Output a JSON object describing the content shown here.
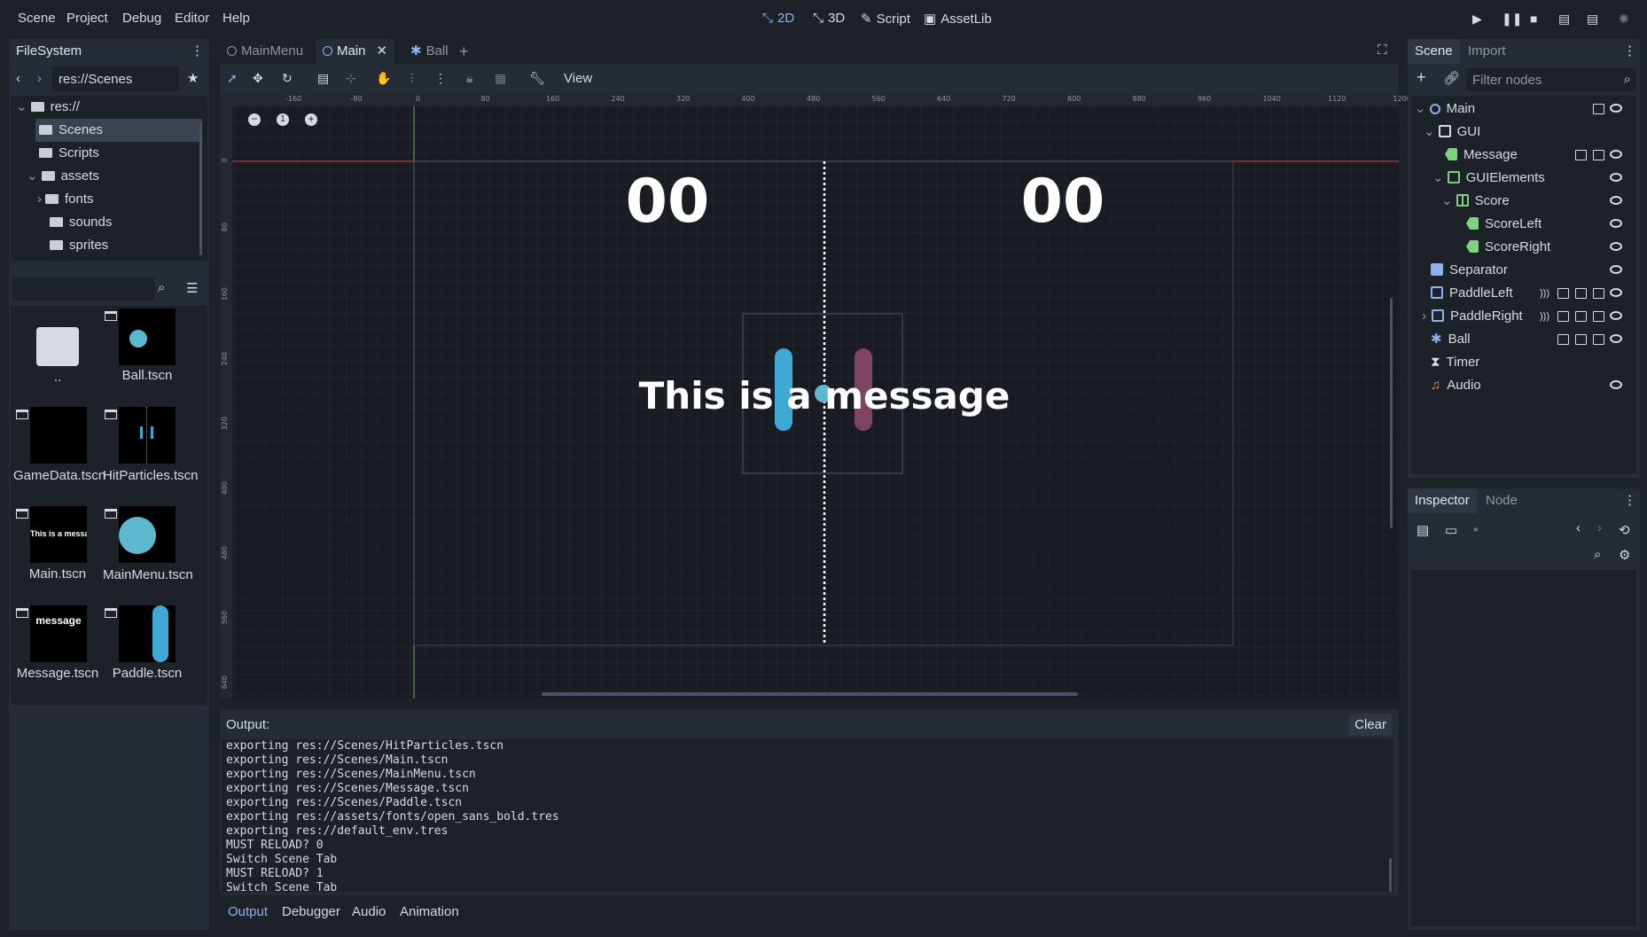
{
  "menubar": {
    "items": [
      "Scene",
      "Project",
      "Debug",
      "Editor",
      "Help"
    ],
    "workspaces": {
      "w2d": "2D",
      "w3d": "3D",
      "script": "Script",
      "assetlib": "AssetLib"
    }
  },
  "filesystem": {
    "title": "FileSystem",
    "path": "res://Scenes",
    "tree": {
      "root": "res://",
      "scenes": "Scenes",
      "scripts": "Scripts",
      "assets": "assets",
      "fonts": "fonts",
      "sounds": "sounds",
      "sprites": "sprites"
    },
    "files": {
      "up": "..",
      "ball": "Ball.tscn",
      "gamedata": "GameData.tscn",
      "hitparticles": "HitParticles.tscn",
      "main": "Main.tscn",
      "mainmenu": "MainMenu.tscn",
      "message": "Message.tscn",
      "paddle": "Paddle.tscn"
    },
    "thumb_text": {
      "main": "This is a message",
      "message": "message"
    }
  },
  "editor_tabs": {
    "mainmenu": "MainMenu",
    "main": "Main",
    "ball": "Ball"
  },
  "toolbar": {
    "view": "View"
  },
  "viewport": {
    "score_left": "00",
    "score_right": "00",
    "message": "This is a message",
    "ruler_x": [
      "-160",
      "-80",
      "0",
      "80",
      "160",
      "240",
      "320",
      "400",
      "480",
      "560",
      "640",
      "720",
      "800",
      "880",
      "960",
      "1040",
      "1120",
      "1200"
    ],
    "ruler_y": [
      "0",
      "80",
      "160",
      "240",
      "320",
      "400",
      "480",
      "560",
      "640"
    ]
  },
  "scene_dock": {
    "tab_scene": "Scene",
    "tab_import": "Import",
    "filter_placeholder": "Filter nodes",
    "nodes": {
      "main": "Main",
      "gui": "GUI",
      "message": "Message",
      "guielements": "GUIElements",
      "score": "Score",
      "scoreleft": "ScoreLeft",
      "scoreright": "ScoreRight",
      "separator": "Separator",
      "paddleleft": "PaddleLeft",
      "paddleright": "PaddleRight",
      "ball": "Ball",
      "timer": "Timer",
      "audio": "Audio"
    }
  },
  "inspector": {
    "tab_inspector": "Inspector",
    "tab_node": "Node"
  },
  "output": {
    "label": "Output:",
    "clear": "Clear",
    "lines": [
      "exporting res://Scenes/HitParticles.tscn",
      "exporting res://Scenes/Main.tscn",
      "exporting res://Scenes/MainMenu.tscn",
      "exporting res://Scenes/Message.tscn",
      "exporting res://Scenes/Paddle.tscn",
      "exporting res://assets/fonts/open_sans_bold.tres",
      "exporting res://default_env.tres",
      "MUST RELOAD? 0",
      "Switch Scene Tab",
      "MUST RELOAD? 1",
      "Switch Scene Tab"
    ]
  },
  "bottom_tabs": {
    "output": "Output",
    "debugger": "Debugger",
    "audio": "Audio",
    "animation": "Animation"
  },
  "colors": {
    "accent": "#8fb2ef",
    "panel": "#262c36",
    "bg": "#1d2229",
    "viewport": "#191c22",
    "paddle": "#3fa9d6"
  }
}
